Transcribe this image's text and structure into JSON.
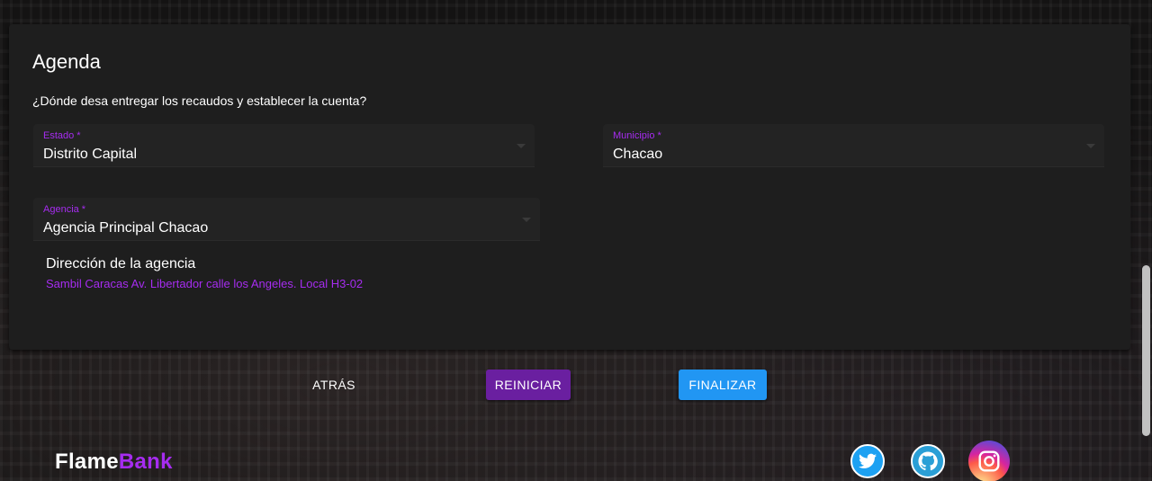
{
  "card": {
    "title": "Agenda",
    "question": "¿Dónde desa entregar los recaudos y establecer la cuenta?"
  },
  "fields": {
    "estado": {
      "label": "Estado *",
      "value": "Distrito Capital"
    },
    "municipio": {
      "label": "Municipio *",
      "value": "Chacao"
    },
    "agencia": {
      "label": "Agencia *",
      "value": "Agencia Principal Chacao"
    }
  },
  "address": {
    "title": "Dirección de la agencia",
    "value": "Sambil Caracas Av. Libertador calle los Angeles. Local H3-02"
  },
  "buttons": {
    "back": "ATRÁS",
    "reset": "REINICIAR",
    "finish": "FINALIZAR"
  },
  "footer": {
    "logo_part1": "Flame",
    "logo_part2": "Bank",
    "social": [
      "twitter-icon",
      "github-icon",
      "instagram-icon"
    ]
  },
  "colors": {
    "accent": "#a62cf0",
    "reset_button": "#6a1fa0",
    "finish_button": "#2196f3",
    "card_bg": "#1e1e1e"
  }
}
